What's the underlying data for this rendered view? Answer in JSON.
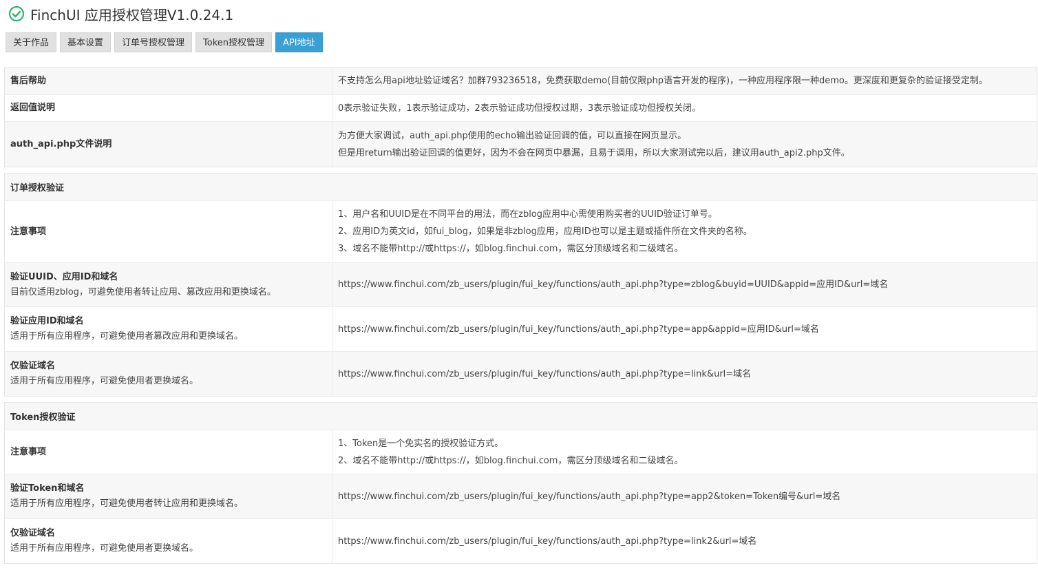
{
  "app": {
    "title": "FinchUI 应用授权管理V1.0.24.1",
    "accent": "#3a9fd4",
    "status_icon": "check-circle-icon",
    "status_color": "#2ab56b"
  },
  "tabs": [
    {
      "label": "关于作品",
      "active": false
    },
    {
      "label": "基本设置",
      "active": false
    },
    {
      "label": "订单号授权管理",
      "active": false
    },
    {
      "label": "Token授权管理",
      "active": false
    },
    {
      "label": "API地址",
      "active": true
    }
  ],
  "info": {
    "after_sales": {
      "label": "售后帮助",
      "text": "不支持怎么用api地址验证域名？加群793236518，免费获取demo(目前仅限php语言开发的程序)，一种应用程序限一种demo。更深度和更复杂的验证接受定制。"
    },
    "return_value": {
      "label": "返回值说明",
      "text": "0表示验证失败，1表示验证成功，2表示验证成功但授权过期，3表示验证成功但授权关闭。"
    },
    "auth_api_file": {
      "label": "auth_api.php文件说明",
      "line1": "为方便大家调试，auth_api.php使用的echo输出验证回调的值，可以直接在网页显示。",
      "line2": "但是用return输出验证回调的值更好，因为不会在网页中暴漏，且易于调用，所以大家测试完以后，建议用auth_api2.php文件。"
    }
  },
  "order_auth": {
    "heading": "订单授权验证",
    "notes": {
      "label": "注意事项",
      "lines": [
        "1、用户名和UUID是在不同平台的用法，而在zblog应用中心需使用购买者的UUID验证订单号。",
        "2、应用ID为英文id，如fui_blog，如果是非zblog应用，应用ID也可以是主题或插件所在文件夹的名称。",
        "3、域名不能带http://或https://，如blog.finchui.com，需区分顶级域名和二级域名。"
      ]
    },
    "verify_uuid": {
      "label": "验证UUID、应用ID和域名",
      "sub": "目前仅适用zblog，可避免使用者转让应用、篡改应用和更换域名。",
      "url": "https://www.finchui.com/zb_users/plugin/fui_key/functions/auth_api.php?type=zblog&buyid=UUID&appid=应用ID&url=域名"
    },
    "verify_app": {
      "label": "验证应用ID和域名",
      "sub": "适用于所有应用程序，可避免使用者篡改应用和更换域名。",
      "url": "https://www.finchui.com/zb_users/plugin/fui_key/functions/auth_api.php?type=app&appid=应用ID&url=域名"
    },
    "verify_domain": {
      "label": "仅验证域名",
      "sub": "适用于所有应用程序，可避免使用者更换域名。",
      "url": "https://www.finchui.com/zb_users/plugin/fui_key/functions/auth_api.php?type=link&url=域名"
    }
  },
  "token_auth": {
    "heading": "Token授权验证",
    "notes": {
      "label": "注意事项",
      "lines": [
        "1、Token是一个免实名的授权验证方式。",
        "2、域名不能带http://或https://，如blog.finchui.com，需区分顶级域名和二级域名。"
      ]
    },
    "verify_token": {
      "label": "验证Token和域名",
      "sub": "适用于所有应用程序，可避免使用者转让应用和更换域名。",
      "url": "https://www.finchui.com/zb_users/plugin/fui_key/functions/auth_api.php?type=app2&token=Token编号&url=域名"
    },
    "verify_domain": {
      "label": "仅验证域名",
      "sub": "适用于所有应用程序，可避免使用者更换域名。",
      "url": "https://www.finchui.com/zb_users/plugin/fui_key/functions/auth_api.php?type=link2&url=域名"
    }
  }
}
